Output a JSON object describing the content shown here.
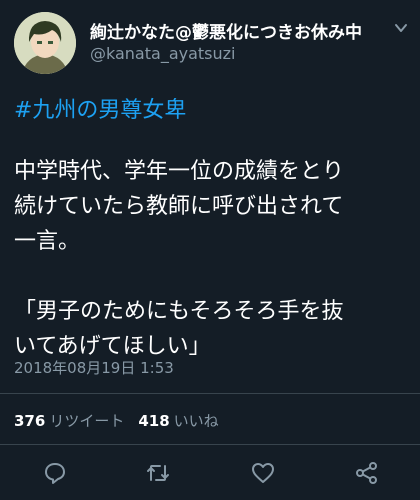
{
  "tweet": {
    "display_name": "絢辻かなた@鬱悪化につきお休み中",
    "handle": "@kanata_ayatsuzi",
    "hashtag": "#九州の男尊女卑",
    "paragraph1": "中学時代、学年一位の成績をとり\n続けていたら教師に呼び出されて\n一言。",
    "paragraph2": "「男子のためにもそろそろ手を抜\nいてあげてほしい」",
    "timestamp": "2018年08月19日 1:53",
    "retweet_count": "376",
    "retweet_label": "リツイート",
    "like_count": "418",
    "like_label": "いいね"
  },
  "icons": {
    "menu": "chevron-down-icon",
    "reply": "reply-icon",
    "retweet": "retweet-icon",
    "like": "heart-icon",
    "share": "share-icon"
  },
  "colors": {
    "background": "#141d26",
    "link": "#1da1f2",
    "secondary_text": "#8899a6",
    "divider": "#38444d"
  }
}
